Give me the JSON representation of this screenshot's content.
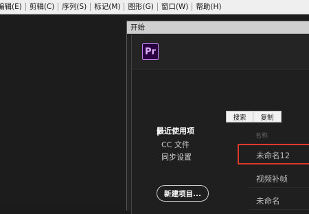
{
  "menubar": {
    "items": [
      "编辑(E)",
      "剪辑(C)",
      "序列(S)",
      "标记(M)",
      "图形(G)",
      "窗口(W)",
      "帮助(H)"
    ]
  },
  "dialog": {
    "title": "开始",
    "logo_text": "Pr",
    "buttons": {
      "search": "搜索",
      "copy": "复制"
    },
    "nav": {
      "recent": "最近使用项",
      "cc_files": "CC 文件",
      "sync": "同步设置"
    },
    "column_header": "名称",
    "files": [
      "未命名12",
      "视频补帧",
      "未命名"
    ],
    "new_project": "新建项目..."
  },
  "colors": {
    "accent_highlight": "#e23a2a",
    "logo_border": "#c27df0",
    "logo_bg": "#2a0040"
  }
}
